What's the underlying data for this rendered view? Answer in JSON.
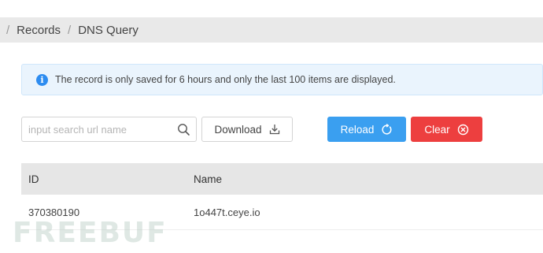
{
  "breadcrumb": {
    "separator": "/",
    "items": [
      "Records",
      "DNS Query"
    ]
  },
  "alert": {
    "icon": "info-icon",
    "icon_glyph": "i",
    "text": "The record is only saved for 6 hours and only the last 100 items are displayed."
  },
  "search": {
    "placeholder": "input search url name",
    "value": ""
  },
  "buttons": {
    "download": "Download",
    "reload": "Reload",
    "clear": "Clear"
  },
  "table": {
    "columns": [
      "ID",
      "Name"
    ],
    "rows": [
      [
        "370380190",
        "1o447t.ceye.io"
      ]
    ]
  },
  "watermark": "FREEBUF",
  "colors": {
    "reload": "#3a9ff0",
    "clear": "#ed3f3f",
    "alert_bg": "#eaf4fd",
    "info": "#2d8cf0",
    "header_bg": "#e6e6e6"
  }
}
